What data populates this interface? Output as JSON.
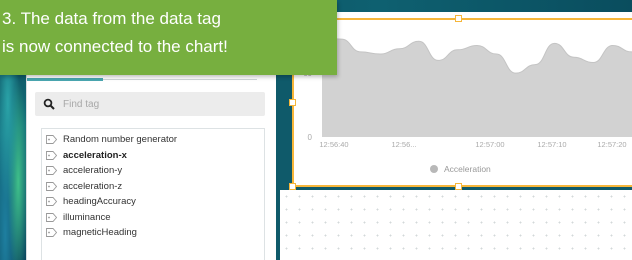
{
  "callout": {
    "line1": "3. The data from the data tag",
    "line2": "is now connected to the chart!",
    "color": "#77af3f"
  },
  "tag_panel": {
    "search_placeholder": "Find tag",
    "tags": [
      {
        "label": "Random number generator",
        "bold": false
      },
      {
        "label": "acceleration-x",
        "bold": true
      },
      {
        "label": "acceleration-y",
        "bold": false
      },
      {
        "label": "acceleration-z",
        "bold": false
      },
      {
        "label": "headingAccuracy",
        "bold": false
      },
      {
        "label": "illuminance",
        "bold": false
      },
      {
        "label": "magneticHeading",
        "bold": false
      }
    ]
  },
  "chart": {
    "legend_label": "Acceleration",
    "accent_color": "#f6b63a",
    "area_color": "#d2d2d2"
  },
  "chart_data": {
    "type": "area",
    "ylim": [
      0,
      110
    ],
    "yticks": [
      0,
      60
    ],
    "x_tick_labels": [
      "12:56:40",
      "12:56...",
      "12:57:00",
      "12:57:10",
      "12:57:20"
    ],
    "x": [
      "12:56:40",
      "12:56:43",
      "12:56:46",
      "12:56:49",
      "12:56:52",
      "12:56:55",
      "12:56:58",
      "12:57:01",
      "12:57:04",
      "12:57:07",
      "12:57:10",
      "12:57:13",
      "12:57:16",
      "12:57:19",
      "12:57:22",
      "12:57:25",
      "12:57:28"
    ],
    "series": [
      {
        "name": "Acceleration",
        "values": [
          95,
          92,
          80,
          78,
          83,
          90,
          72,
          82,
          86,
          78,
          60,
          68,
          88,
          75,
          70,
          86,
          80
        ]
      }
    ]
  }
}
